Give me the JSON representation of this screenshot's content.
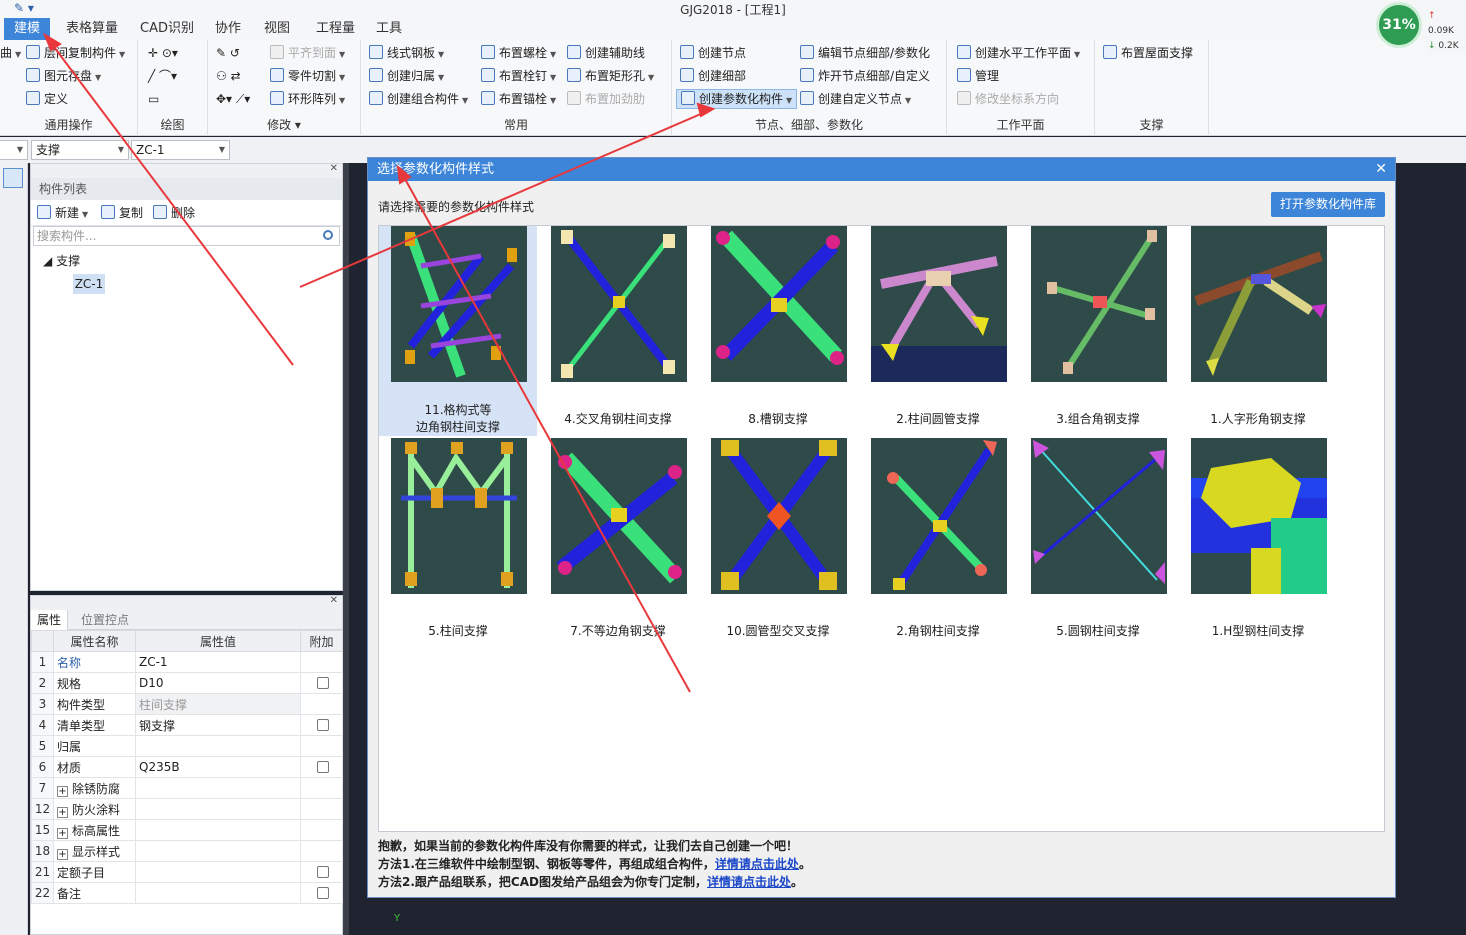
{
  "window": {
    "title": "GJG2018 - [工程1]"
  },
  "menu_tabs": [
    "建模",
    "表格算量",
    "CAD识别",
    "协作",
    "视图",
    "工程量",
    "工具"
  ],
  "ribbon": {
    "general": {
      "label": "通用操作",
      "items": [
        "曲",
        "图元存盘",
        "定义",
        "层间复制构件"
      ]
    },
    "draw": {
      "label": "绘图"
    },
    "modify": {
      "label": "修改",
      "items": [
        "平齐到面",
        "零件切割",
        "环形阵列"
      ]
    },
    "common": {
      "label": "常用",
      "items": [
        "线式钢板",
        "创建归属",
        "创建组合构件",
        "布置螺栓",
        "布置栓钉",
        "布置锚栓",
        "创建辅助线",
        "布置矩形孔",
        "布置加劲肋"
      ]
    },
    "node": {
      "label": "节点、细部、参数化",
      "items": [
        "创建节点",
        "创建细部",
        "创建参数化构件",
        "编辑节点细部/参数化",
        "炸开节点细部/自定义",
        "创建自定义节点"
      ]
    },
    "workplane": {
      "label": "工作平面",
      "items": [
        "创建水平工作平面",
        "管理",
        "修改坐标系方向"
      ]
    },
    "support": {
      "label": "支撑",
      "items": [
        "布置屋面支撑"
      ]
    }
  },
  "combos": {
    "category": "支撑",
    "component": "ZC-1"
  },
  "component_list": {
    "title": "构件列表",
    "tools": [
      "新建",
      "复制",
      "删除"
    ],
    "search_placeholder": "搜索构件...",
    "tree_root": "支撑",
    "tree_child": "ZC-1"
  },
  "properties": {
    "tabs": [
      "属性",
      "位置控点"
    ],
    "headers": [
      "属性名称",
      "属性值",
      "附加"
    ],
    "rows": [
      {
        "idx": "1",
        "name": "名称",
        "value": "ZC-1",
        "check": false
      },
      {
        "idx": "2",
        "name": "规格",
        "value": "D10",
        "check": true
      },
      {
        "idx": "3",
        "name": "构件类型",
        "value": "柱间支撑",
        "check": false
      },
      {
        "idx": "4",
        "name": "清单类型",
        "value": "钢支撑",
        "check": true
      },
      {
        "idx": "5",
        "name": "归属",
        "value": "",
        "check": false
      },
      {
        "idx": "6",
        "name": "材质",
        "value": "Q235B",
        "check": true
      },
      {
        "idx": "7",
        "name": "除锈防腐",
        "value": "",
        "check": false
      },
      {
        "idx": "12",
        "name": "防火涂料",
        "value": "",
        "check": false
      },
      {
        "idx": "15",
        "name": "标高属性",
        "value": "",
        "check": false
      },
      {
        "idx": "18",
        "name": "显示样式",
        "value": "",
        "check": false
      },
      {
        "idx": "21",
        "name": "定额子目",
        "value": "",
        "check": true
      },
      {
        "idx": "22",
        "name": "备注",
        "value": "",
        "check": true
      }
    ]
  },
  "dialog": {
    "title": "选择参数化构件样式",
    "prompt": "请选择需要的参数化构件样式",
    "open_library": "打开参数化构件库",
    "styles": [
      {
        "line1": "11.格构式等",
        "line2": "边角钢柱间支撑"
      },
      {
        "line1": "4.交叉角钢柱间支撑",
        "line2": ""
      },
      {
        "line1": "8.槽钢支撑",
        "line2": ""
      },
      {
        "line1": "2.柱间圆管支撑",
        "line2": ""
      },
      {
        "line1": "3.组合角钢支撑",
        "line2": ""
      },
      {
        "line1": "1.人字形角钢支撑",
        "line2": ""
      },
      {
        "line1": "5.柱间支撑",
        "line2": ""
      },
      {
        "line1": "7.不等边角钢支撑",
        "line2": ""
      },
      {
        "line1": "10.圆管型交叉支撑",
        "line2": ""
      },
      {
        "line1": "2.角钢柱间支撑",
        "line2": ""
      },
      {
        "line1": "5.圆钢柱间支撑",
        "line2": ""
      },
      {
        "line1": "1.H型钢柱间支撑",
        "line2": ""
      }
    ],
    "notes": {
      "line1": "抱歉，如果当前的参数化构件库没有你需要的样式，让我们去自己创建一个吧！",
      "line2": "方法1.在三维软件中绘制型钢、钢板等零件，再组成组合构件，",
      "line3": "方法2.跟产品组联系，把CAD图发给产品组会为你专门定制，",
      "link": "详情请点击此处",
      "end": "。"
    }
  },
  "status": {
    "cpu": "31%",
    "up": "0.09K",
    "down": "0.2K"
  },
  "viewport": {
    "axis_label": "Y"
  },
  "colors": {
    "accent": "#3d85d8",
    "arrow": "#e8383b",
    "thumb_bg": "#2e4a49"
  }
}
